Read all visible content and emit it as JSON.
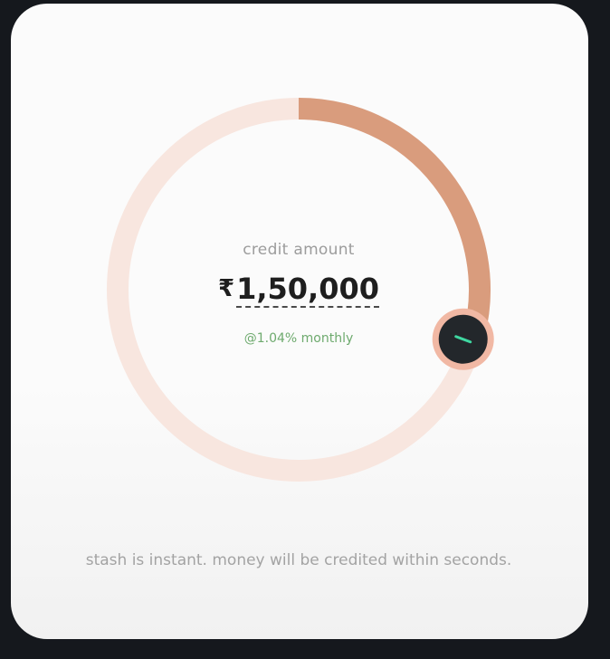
{
  "credit": {
    "label": "credit amount",
    "currency_symbol": "₹",
    "amount": "1,50,000",
    "rate_text": "@1.04% monthly",
    "dial_progress_fraction": 0.29
  },
  "footer": {
    "message": "stash is instant. money will be credited within seconds."
  },
  "colors": {
    "track": "#f8e6df",
    "progress": "#d99c7d",
    "knob": "#23272b",
    "knob_ring": "#f1b8a4",
    "knob_mark": "#3fd7a1",
    "rate_text": "#6eaa6e"
  }
}
